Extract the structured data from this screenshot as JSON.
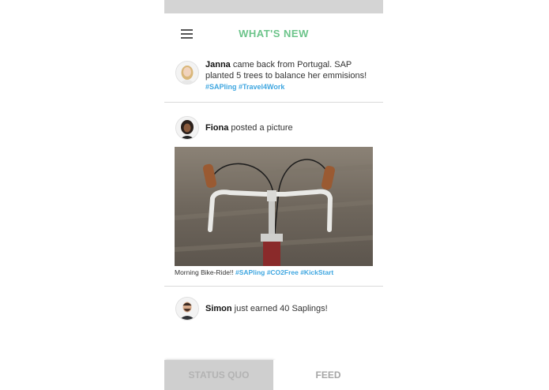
{
  "header": {
    "title": "WHAT'S NEW",
    "menu_icon": "hamburger-menu-icon"
  },
  "feed": {
    "janna": {
      "name": "Janna",
      "text": " came back from Portugal. SAP planted 5 trees to balance her emmisions!",
      "hashtags": "#SAPling #Travel4Work"
    },
    "fiona": {
      "name": "Fiona",
      "text": " posted a picture",
      "caption": "Morning Bike-Ride!! ",
      "hashtags": "#SAPling #CO2Free #KickStart"
    },
    "simon": {
      "name": "Simon",
      "text": " just earned 40 Saplings!"
    }
  },
  "tabs": {
    "status_quo": "STATUS QUO",
    "feed": "FEED"
  },
  "colors": {
    "accent": "#6cc48a",
    "hashtag": "#3ea6e0"
  }
}
